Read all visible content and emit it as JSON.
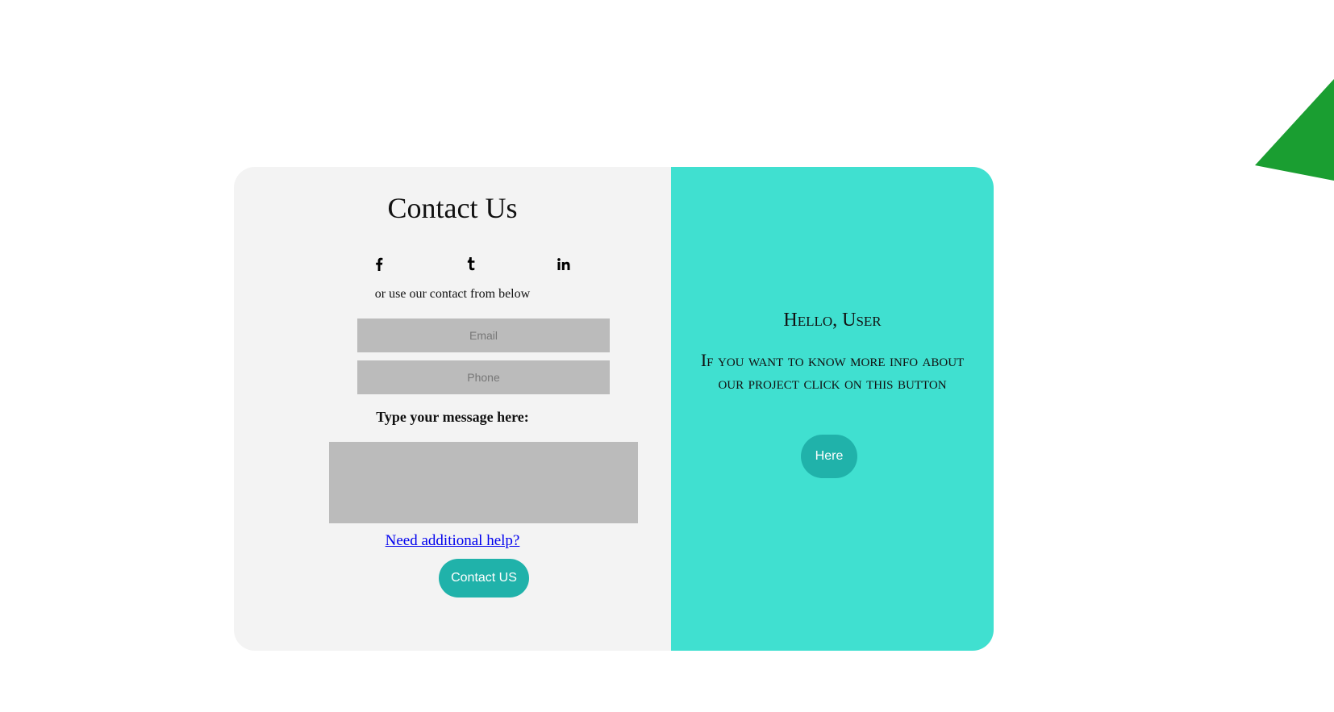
{
  "colors": {
    "left_panel": "#f3f3f3",
    "right_panel": "#40e0d0",
    "button": "#20b2aa",
    "field": "#bbbbbb",
    "decor_triangle": "#1a9e31",
    "link": "#0000ee"
  },
  "contact": {
    "title": "Contact Us",
    "social_icons": [
      "facebook-icon",
      "tumblr-icon",
      "linkedin-icon"
    ],
    "subtitle": "or use our contact from below",
    "email_placeholder": "Email",
    "phone_placeholder": "Phone",
    "message_label": "Type your message here:",
    "help_link": "Need additional help?",
    "submit_label": "Contact US"
  },
  "info_panel": {
    "greeting": "Hello, User",
    "text": "If you want to know more info about our project click on this button",
    "button_label": "Here"
  }
}
